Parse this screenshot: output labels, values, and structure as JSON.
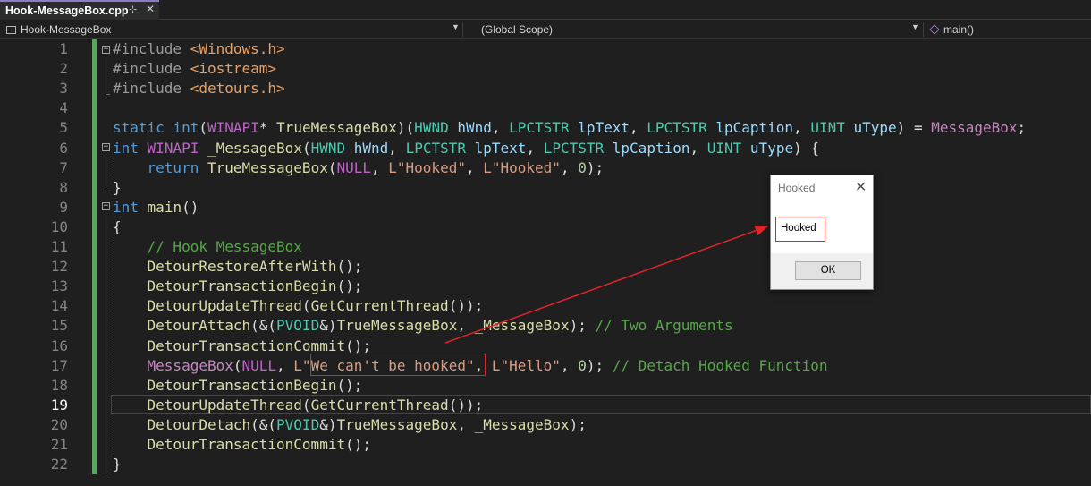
{
  "tab": {
    "title": "Hook-MessageBox.cpp",
    "pin_icon": "pin-icon",
    "close_icon": "close-icon"
  },
  "navbar": {
    "project": "Hook-MessageBox",
    "scope": "(Global Scope)",
    "member": "main()"
  },
  "lines": [
    {
      "n": "1",
      "html": "<span class='pp'>#include</span> <span class='inc'>&lt;Windows.h&gt;</span>"
    },
    {
      "n": "2",
      "html": "<span class='pp'>#include</span> <span class='inc'>&lt;iostream&gt;</span>"
    },
    {
      "n": "3",
      "html": "<span class='pp'>#include</span> <span class='inc'>&lt;detours.h&gt;</span>"
    },
    {
      "n": "4",
      "html": ""
    },
    {
      "n": "5",
      "html": "<span class='kw'>static</span> <span class='kw'>int</span>(<span class='macro2'>WINAPI</span>* <span class='fn'>TrueMessageBox</span>)(<span class='ty'>HWND</span> <span class='par'>hWnd</span>, <span class='ty'>LPCTSTR</span> <span class='par'>lpText</span>, <span class='ty'>LPCTSTR</span> <span class='par'>lpCaption</span>, <span class='ty'>UINT</span> <span class='par'>uType</span>) = <span class='mac'>MessageBox</span>;"
    },
    {
      "n": "6",
      "html": "<span class='kw'>int</span> <span class='macro2'>WINAPI</span> <span class='fn'>_MessageBox</span>(<span class='ty'>HWND</span> <span class='par'>hWnd</span>, <span class='ty'>LPCTSTR</span> <span class='par'>lpText</span>, <span class='ty'>LPCTSTR</span> <span class='par'>lpCaption</span>, <span class='ty'>UINT</span> <span class='par'>uType</span>) {"
    },
    {
      "n": "7",
      "html": "    <span class='kw'>return</span> <span class='fn'>TrueMessageBox</span>(<span class='macro2'>NULL</span>, <span class='str'>L\"Hooked\"</span>, <span class='str'>L\"Hooked\"</span>, <span class='num'>0</span>);"
    },
    {
      "n": "8",
      "html": "}"
    },
    {
      "n": "9",
      "html": "<span class='kw'>int</span> <span class='fn'>main</span>()"
    },
    {
      "n": "10",
      "html": "{"
    },
    {
      "n": "11",
      "html": "    <span class='cm'>// Hook MessageBox</span>"
    },
    {
      "n": "12",
      "html": "    <span class='fn'>DetourRestoreAfterWith</span>();"
    },
    {
      "n": "13",
      "html": "    <span class='fn'>DetourTransactionBegin</span>();"
    },
    {
      "n": "14",
      "html": "    <span class='fn'>DetourUpdateThread</span>(<span class='fn'>GetCurrentThread</span>());"
    },
    {
      "n": "15",
      "html": "    <span class='fn'>DetourAttach</span>(&amp;(<span class='ty'>PVOID</span>&amp;)<span class='fn'>TrueMessageBox</span>, <span class='fn'>_MessageBox</span>); <span class='cm'>// Two Arguments</span>"
    },
    {
      "n": "16",
      "html": "    <span class='fn'>DetourTransactionCommit</span>();"
    },
    {
      "n": "17",
      "html": "    <span class='mac'>MessageBox</span>(<span class='macro2'>NULL</span>, <span class='str'>L\"We can't be hooked\"</span>, <span class='str'>L\"Hello\"</span>, <span class='num'>0</span>); <span class='cm'>// Detach Hooked Function</span>"
    },
    {
      "n": "18",
      "html": "    <span class='fn'>DetourTransactionBegin</span>();"
    },
    {
      "n": "19",
      "html": "    <span class='fn'>DetourUpdateThread</span>(<span class='fn'>GetCurrentThread</span>());"
    },
    {
      "n": "20",
      "html": "    <span class='fn'>DetourDetach</span>(&amp;(<span class='ty'>PVOID</span>&amp;)<span class='fn'>TrueMessageBox</span>, <span class='fn'>_MessageBox</span>);"
    },
    {
      "n": "21",
      "html": "    <span class='fn'>DetourTransactionCommit</span>();"
    },
    {
      "n": "22",
      "html": "}"
    }
  ],
  "active_line": "19",
  "dialog": {
    "title": "Hooked",
    "message": "Hooked",
    "ok_label": "OK"
  },
  "colors": {
    "annotation": "#e0242a",
    "change_bar": "#4caf50"
  }
}
